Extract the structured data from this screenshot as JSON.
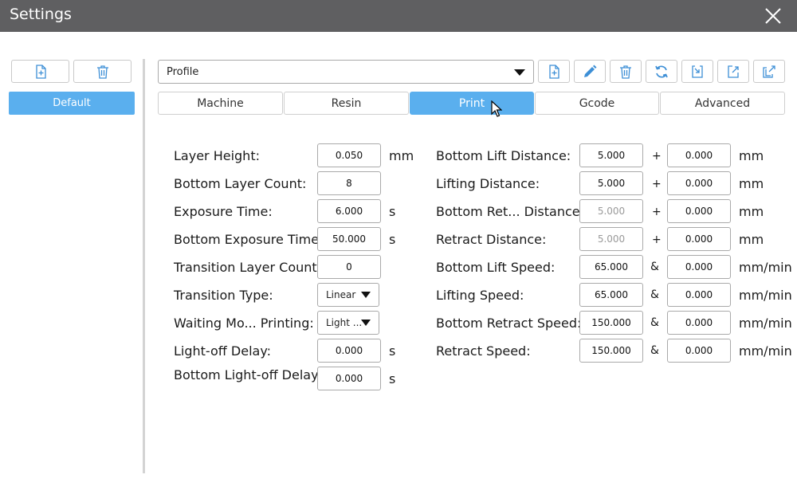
{
  "window": {
    "title": "Settings"
  },
  "left_panel": {
    "profiles": [
      "Default"
    ]
  },
  "profile_select": {
    "value": "Profile"
  },
  "tabs": [
    "Machine",
    "Resin",
    "Print",
    "Gcode",
    "Advanced"
  ],
  "active_tab": "Print",
  "left_fields": [
    {
      "label": "Layer Height:",
      "value": "0.050",
      "unit": "mm"
    },
    {
      "label": "Bottom Layer Count:",
      "value": "8",
      "unit": ""
    },
    {
      "label": "Exposure Time:",
      "value": "6.000",
      "unit": "s"
    },
    {
      "label": "Bottom Exposure Time:",
      "value": "50.000",
      "unit": "s"
    },
    {
      "label": "Transition Layer Count:",
      "value": "0",
      "unit": ""
    },
    {
      "label": "Transition Type:",
      "value": "Linear",
      "unit": ""
    },
    {
      "label": "Waiting Mo... Printing:",
      "value": "Light ...",
      "unit": ""
    },
    {
      "label": "Light-off Delay:",
      "value": "0.000",
      "unit": "s"
    },
    {
      "label": "Bottom Light-off Delay:",
      "value": "0.000",
      "unit": "s"
    }
  ],
  "right_fields": [
    {
      "label": "Bottom Lift Distance:",
      "value1": "5.000",
      "op": "+",
      "value2": "0.000",
      "unit": "mm"
    },
    {
      "label": "Lifting Distance:",
      "value1": "5.000",
      "op": "+",
      "value2": "0.000",
      "unit": "mm"
    },
    {
      "label": "Bottom Ret... Distance:",
      "value1": "5.000",
      "op": "+",
      "value2": "0.000",
      "unit": "mm"
    },
    {
      "label": "Retract Distance:",
      "value1": "5.000",
      "op": "+",
      "value2": "0.000",
      "unit": "mm"
    },
    {
      "label": "Bottom Lift Speed:",
      "value1": "65.000",
      "op": "&",
      "value2": "0.000",
      "unit": "mm/min"
    },
    {
      "label": "Lifting Speed:",
      "value1": "65.000",
      "op": "&",
      "value2": "0.000",
      "unit": "mm/min"
    },
    {
      "label": "Bottom Retract Speed:",
      "value1": "150.000",
      "op": "&",
      "value2": "0.000",
      "unit": "mm/min"
    },
    {
      "label": "Retract Speed:",
      "value1": "150.000",
      "op": "&",
      "value2": "0.000",
      "unit": "mm/min"
    }
  ],
  "icons": {
    "left_toolbar": [
      "add-file-icon",
      "trash-icon"
    ],
    "right_toolbar": [
      "add-file-icon",
      "pencil-icon",
      "trash-icon",
      "refresh-icon",
      "import-icon",
      "export-icon",
      "share-icon"
    ]
  },
  "colors": {
    "accent": "#5aafee",
    "titlebar": "#5f5f61"
  }
}
